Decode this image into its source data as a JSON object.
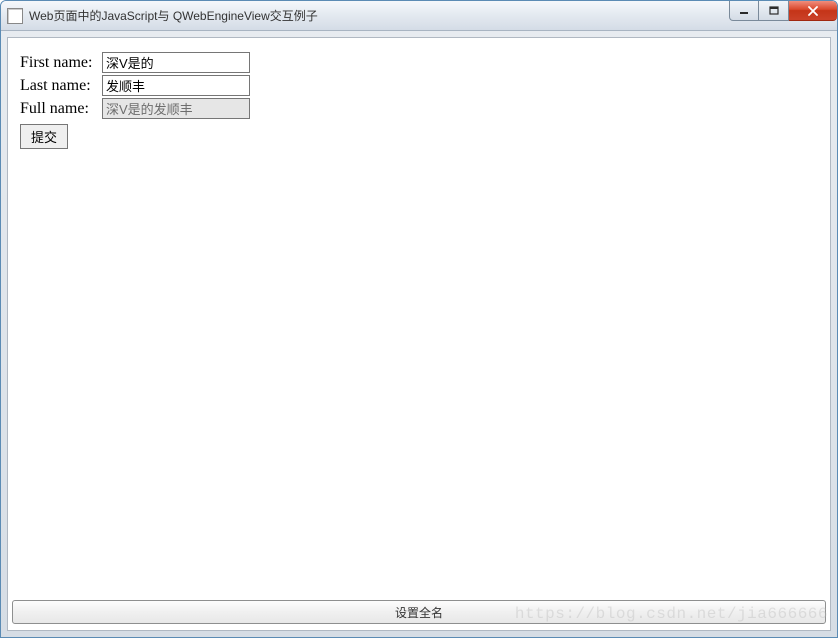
{
  "window": {
    "title": "Web页面中的JavaScript与 QWebEngineView交互例子"
  },
  "form": {
    "firstNameLabel": "First name:",
    "firstNameValue": "深V是的",
    "lastNameLabel": "Last name:",
    "lastNameValue": "发顺丰",
    "fullNameLabel": "Full name:",
    "fullNameValue": "深V是的发顺丰",
    "submitLabel": "提交"
  },
  "bottomButton": {
    "label": "设置全名"
  },
  "watermark": "https://blog.csdn.net/jia666666"
}
